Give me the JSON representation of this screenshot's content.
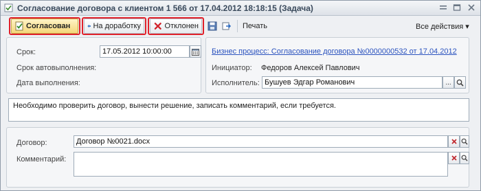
{
  "window": {
    "title": "Согласование договора с клиентом 1 566 от 17.04.2012 18:18:15 (Задача)"
  },
  "toolbar": {
    "approve_label": "Согласован",
    "rework_label": "На доработку",
    "reject_label": "Отклонен",
    "print_label": "Печать",
    "all_actions_label": "Все действия ▾"
  },
  "left_panel": {
    "deadline_label": "Срок:",
    "deadline_value": "17.05.2012 10:00:00",
    "auto_deadline_label": "Срок автовыполнения:",
    "completion_date_label": "Дата выполнения:"
  },
  "right_panel": {
    "process_link": "Бизнес процесс: Согласование договора №0000000532 от 17.04.2012",
    "initiator_label": "Инициатор:",
    "initiator_value": "Федоров Алексей Павлович",
    "executor_label": "Исполнитель:",
    "executor_value": "Бушуев Эдгар Романович"
  },
  "description": {
    "text": "Необходимо проверить договор, вынести решение, записать комментарий, если требуется."
  },
  "bottom_panel": {
    "contract_label": "Договор:",
    "contract_value": "Договор №0021.docx",
    "comment_label": "Комментарий:",
    "comment_value": ""
  },
  "colors": {
    "highlight_frame": "#e0202a",
    "link": "#2a52be",
    "primary_button": "#f4d77a"
  }
}
